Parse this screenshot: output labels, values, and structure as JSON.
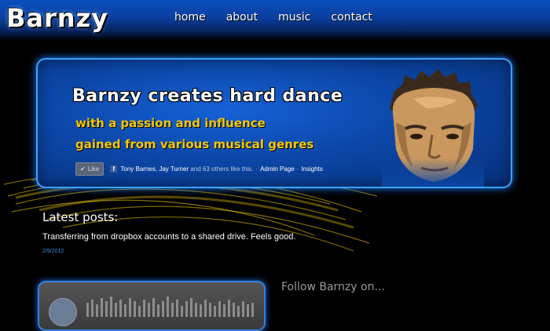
{
  "header": {
    "logo": "Barnzy",
    "nav": [
      "home",
      "about",
      "music",
      "contact"
    ]
  },
  "hero": {
    "title": "Barnzy creates hard dance",
    "subtitle_line1": "with a passion and influence",
    "subtitle_line2": "gained from various musical genres",
    "facebook": {
      "like_label": "Like",
      "friend1": "Tony Barnes",
      "friend2": "Jay Turner",
      "others": "and 63 others like this.",
      "admin_link": "Admin Page",
      "insights_link": "Insights"
    }
  },
  "latest_posts": {
    "heading": "Latest posts:",
    "post_text": "Transferring from dropbox accounts to a shared drive. Feels good.",
    "post_date": "2/9/2012"
  },
  "follow": {
    "heading": "Follow Barnzy on..."
  },
  "colors": {
    "accent_blue": "#3aa3ff",
    "subtitle_yellow": "#f5c800",
    "date_blue": "#3a8fe8",
    "facebook_blue": "#3b5998"
  }
}
